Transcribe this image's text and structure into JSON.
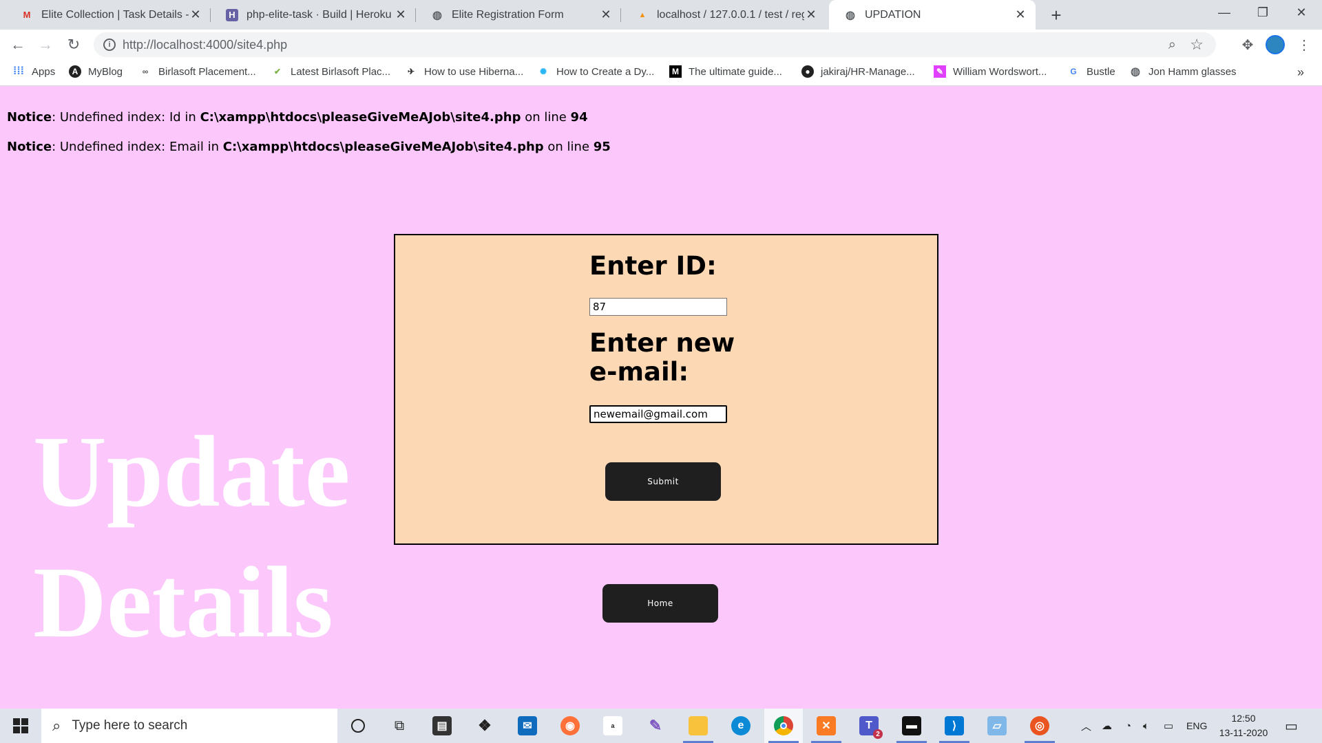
{
  "browser": {
    "tabs": [
      {
        "title": "Elite Collection | Task Details - vis",
        "favicon": "gmail-icon"
      },
      {
        "title": "php-elite-task · Build | Heroku",
        "favicon": "heroku-icon"
      },
      {
        "title": "Elite Registration Form",
        "favicon": "globe-icon"
      },
      {
        "title": "localhost / 127.0.0.1 / test / regis",
        "favicon": "phpmyadmin-icon"
      },
      {
        "title": "UPDATION",
        "favicon": "globe-icon"
      }
    ],
    "url": "http://localhost:4000/site4.php",
    "bookmarks": [
      "Apps",
      "MyBlog",
      "Birlasoft Placement...",
      "Latest Birlasoft Plac...",
      "How to use Hiberna...",
      "How to Create a Dy...",
      "The ultimate guide...",
      "jakiraj/HR-Manage...",
      "William Wordswort...",
      "Bustle",
      "Jon Hamm glasses"
    ],
    "bookmarks_overflow": "»"
  },
  "page": {
    "notices": [
      {
        "label": "Notice",
        "text1": ": Undefined index: Id in ",
        "path": "C:\\xampp\\htdocs\\pleaseGiveMeAJob\\site4.php",
        "text2": " on line ",
        "line": "94"
      },
      {
        "label": "Notice",
        "text1": ": Undefined index: Email in ",
        "path": "C:\\xampp\\htdocs\\pleaseGiveMeAJob\\site4.php",
        "text2": " on line ",
        "line": "95"
      }
    ],
    "background_title": [
      "Update",
      "Details"
    ],
    "form": {
      "id_label": "Enter ID:",
      "id_value": "87",
      "email_label_line1": "Enter new",
      "email_label_line2": "e-mail:",
      "email_value": "newemail@gmail.com",
      "submit_label": "Submit"
    },
    "home_label": "Home"
  },
  "taskbar": {
    "search_placeholder": "Type here to search",
    "language": "ENG",
    "time": "12:50",
    "date": "13-11-2020",
    "teams_badge": "2"
  },
  "colors": {
    "page_bg": "#fcc8fc",
    "form_bg": "#fcd8b4",
    "button_bg": "#1f1f1f"
  }
}
